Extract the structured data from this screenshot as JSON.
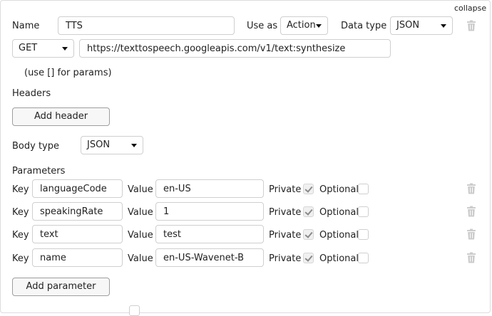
{
  "collapse_label": "collapse",
  "name": {
    "label": "Name",
    "value": "TTS"
  },
  "use_as": {
    "label": "Use as",
    "value": "Action"
  },
  "data_type": {
    "label": "Data type",
    "value": "JSON"
  },
  "method": "GET",
  "url": "https://texttospeech.googleapis.com/v1/text:synthesize",
  "params_hint": "(use [] for params)",
  "headers": {
    "label": "Headers",
    "add_button": "Add header"
  },
  "body_type": {
    "label": "Body type",
    "value": "JSON"
  },
  "parameters": {
    "label": "Parameters",
    "key_label": "Key",
    "value_label": "Value",
    "private_label": "Private",
    "optional_label": "Optional",
    "add_button": "Add parameter",
    "rows": [
      {
        "key": "languageCode",
        "value": "en-US",
        "private": true,
        "optional": false
      },
      {
        "key": "speakingRate",
        "value": "1",
        "private": true,
        "optional": false
      },
      {
        "key": "text",
        "value": "test",
        "private": true,
        "optional": false
      },
      {
        "key": "name",
        "value": "en-US-Wavenet-B",
        "private": true,
        "optional": false
      }
    ]
  },
  "colors": {
    "border": "#cfcfcf",
    "trash": "#cccccc",
    "check": "#8a8a8a"
  }
}
